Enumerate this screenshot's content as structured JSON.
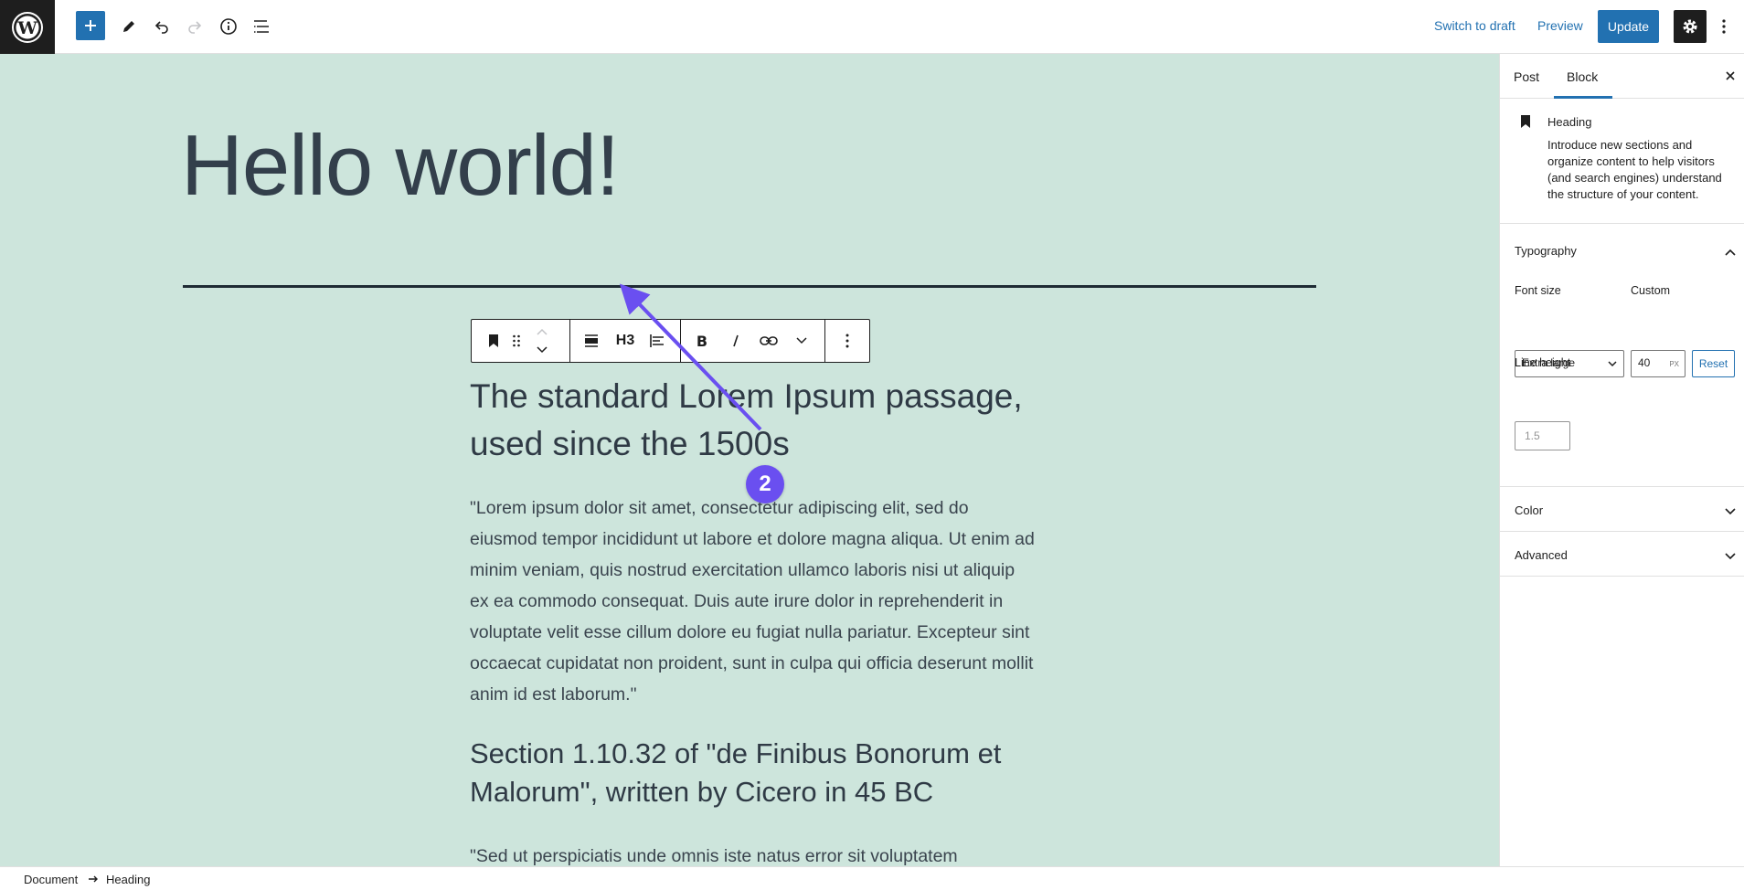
{
  "topbar": {
    "logo_icon": "wordpress-logo-icon",
    "add_block_icon": "plus-icon",
    "tools_icon": "pencil-icon",
    "undo_icon": "undo-icon",
    "redo_icon": "redo-icon",
    "details_icon": "info-icon",
    "list_view_icon": "list-view-icon",
    "switch_to_draft_label": "Switch to draft",
    "preview_label": "Preview",
    "update_label": "Update",
    "settings_icon": "gear-icon",
    "options_icon": "kebab-icon",
    "accent_color": "#2271b1"
  },
  "canvas": {
    "background_color": "#cde5dc",
    "post_title": "Hello world!",
    "block_toolbar": {
      "block_type_icon": "bookmark-icon",
      "drag_icon": "drag-handle-icon",
      "move_up_icon": "chevron-up-icon",
      "move_down_icon": "chevron-down-icon",
      "align_wide_icon": "align-wide-icon",
      "heading_level_label": "H3",
      "text_align_icon": "align-left-icon",
      "bold_icon": "bold-icon",
      "italic_icon": "italic-icon",
      "link_icon": "link-icon",
      "more_formats_icon": "chevron-down-icon",
      "block_options_icon": "kebab-icon"
    },
    "heading_1": "The standard Lorem Ipsum passage, used since the 1500s",
    "paragraph_1": "\"Lorem ipsum dolor sit amet, consectetur adipiscing elit, sed do eiusmod tempor incididunt ut labore et dolore magna aliqua. Ut enim ad minim veniam, quis nostrud exercitation ullamco laboris nisi ut aliquip ex ea commodo consequat. Duis aute irure dolor in reprehenderit in voluptate velit esse cillum dolore eu fugiat nulla pariatur. Excepteur sint occaecat cupidatat non proident, sunt in culpa qui officia deserunt mollit anim id est laborum.\"",
    "heading_2": "Section 1.10.32 of \"de Finibus Bonorum et Malorum\", written by Cicero in 45 BC",
    "paragraph_2": "\"Sed ut perspiciatis unde omnis iste natus error sit voluptatem",
    "annotation": {
      "step_number": "2",
      "color": "#6a4ff0"
    }
  },
  "sidebar": {
    "tabs": [
      {
        "label": "Post",
        "active": false
      },
      {
        "label": "Block",
        "active": true
      }
    ],
    "close_icon": "close-icon",
    "block_card": {
      "icon": "bookmark-icon",
      "title": "Heading",
      "description": "Introduce new sections and organize content to help visitors (and search engines) understand the structure of your content."
    },
    "typography": {
      "title": "Typography",
      "font_size_label": "Font size",
      "custom_label": "Custom",
      "font_size_value": "Extra large",
      "custom_value": "40",
      "custom_unit": "PX",
      "reset_label": "Reset",
      "line_height_label": "Line height",
      "line_height_placeholder": "1.5"
    },
    "color_panel": {
      "title": "Color"
    },
    "advanced_panel": {
      "title": "Advanced"
    }
  },
  "footer": {
    "breadcrumb": [
      "Document",
      "Heading"
    ]
  }
}
